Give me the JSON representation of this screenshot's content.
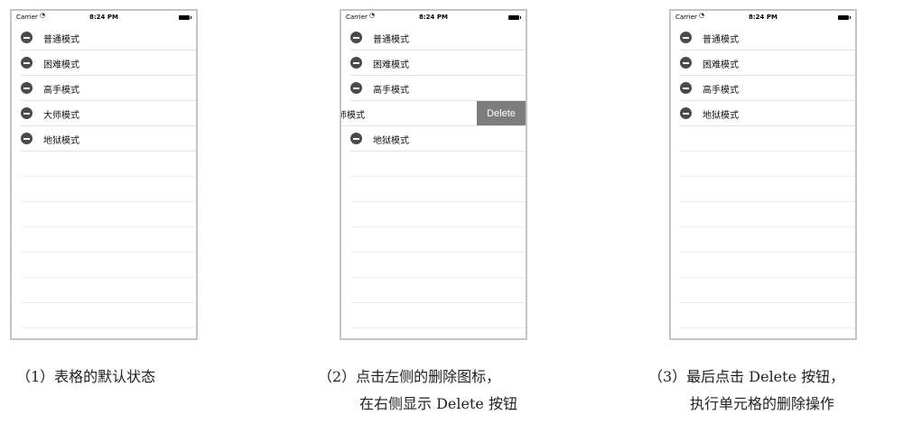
{
  "status_bar": {
    "carrier": "Carrier",
    "wifi_icon": "wifi-icon",
    "time": "8:24 PM"
  },
  "screens": [
    {
      "rows": [
        "普通模式",
        "困难模式",
        "高手模式",
        "大师模式",
        "地狱模式"
      ],
      "caption": [
        "（1）表格的默认状态"
      ]
    },
    {
      "rows": [
        "普通模式",
        "困难模式",
        "高手模式",
        "师模式",
        "地狱模式"
      ],
      "delete_label": "Delete",
      "caption": [
        "（2）点击左侧的删除图标，",
        "在右侧显示 Delete 按钮"
      ]
    },
    {
      "rows": [
        "普通模式",
        "困难模式",
        "高手模式",
        "地狱模式"
      ],
      "caption": [
        "（3）最后点击 Delete 按钮，",
        "执行单元格的删除操作"
      ]
    }
  ]
}
